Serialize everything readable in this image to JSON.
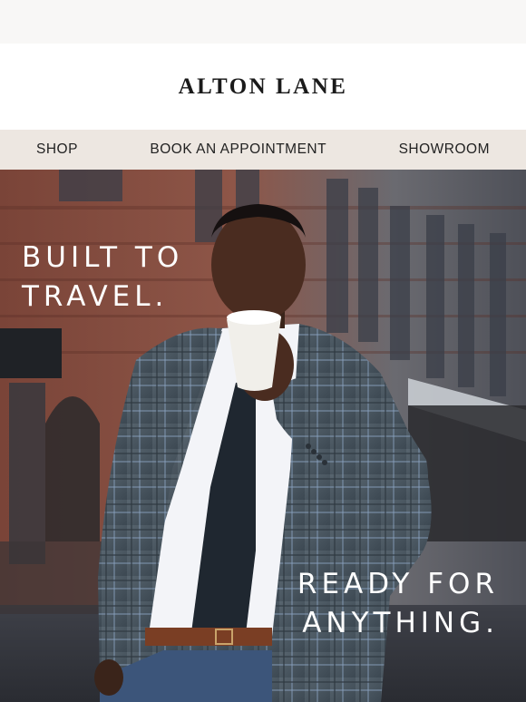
{
  "header": {
    "logo_text": "ALTON LANE"
  },
  "nav": {
    "items": [
      {
        "label": "SHOP"
      },
      {
        "label": "BOOK AN APPOINTMENT"
      },
      {
        "label": "SHOWROOM"
      }
    ]
  },
  "hero": {
    "headline_top": [
      "BUILT TO",
      "TRAVEL."
    ],
    "headline_bottom": [
      "READY FOR",
      "ANYTHING."
    ],
    "colors": {
      "brick": "#8a4a3c",
      "suit": "#4a5a66",
      "text": "#ffffff"
    }
  }
}
